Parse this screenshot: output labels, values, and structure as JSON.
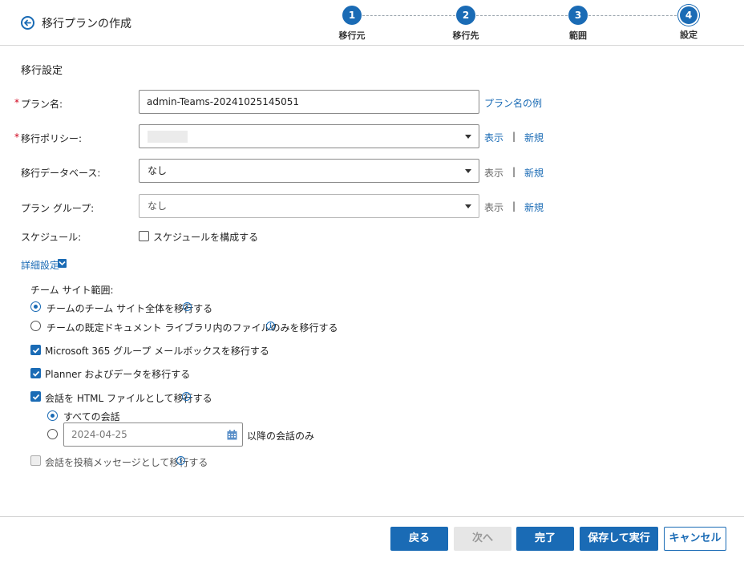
{
  "header": {
    "title": "移行プランの作成",
    "steps": [
      {
        "number": "1",
        "label": "移行元"
      },
      {
        "number": "2",
        "label": "移行先"
      },
      {
        "number": "3",
        "label": "範囲"
      },
      {
        "number": "4",
        "label": "設定"
      }
    ]
  },
  "section": {
    "title": "移行設定"
  },
  "form": {
    "required_mark": "*",
    "plan_name": {
      "label": "プラン名:",
      "value": "admin-Teams-20241025145051",
      "example_link": "プラン名の例"
    },
    "policy": {
      "label": "移行ポリシー:",
      "view": "表示",
      "sep": "|",
      "new": "新規"
    },
    "database": {
      "label": "移行データベース:",
      "value": "なし",
      "view": "表示",
      "sep": "|",
      "new": "新規"
    },
    "group": {
      "label": "プラン グループ:",
      "value": "なし",
      "view": "表示",
      "sep": "|",
      "new": "新規"
    },
    "schedule": {
      "label": "スケジュール:",
      "checkbox_label": "スケジュールを構成する"
    }
  },
  "advanced": {
    "toggle_label": "詳細設定",
    "team_site_scope": {
      "label": "チーム サイト範囲:",
      "options": [
        "チームのチーム サイト全体を移行する",
        "チームの既定ドキュメント ライブラリ内のファイルのみを移行する"
      ]
    },
    "m365_mailbox": "Microsoft 365 グループ メールボックスを移行する",
    "planner": "Planner およびデータを移行する",
    "conversations_html": "会話を HTML ファイルとして移行する",
    "all_conversations": "すべての会話",
    "date_value": "2024-04-25",
    "after_date": "以降の会話のみ",
    "post_messages": "会話を投稿メッセージとして移行する"
  },
  "footer": {
    "back": "戻る",
    "next": "次へ",
    "finish": "完了",
    "save_run": "保存して実行",
    "cancel": "キャンセル"
  },
  "colors": {
    "accent": "#1a6bb5",
    "required": "#d0021b"
  }
}
